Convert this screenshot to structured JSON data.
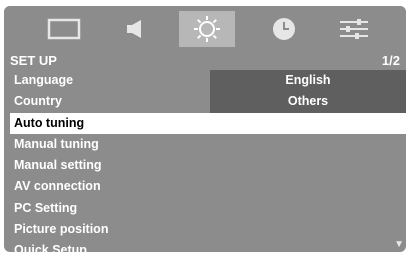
{
  "tabs": [
    {
      "icon": "picture-icon",
      "active": false
    },
    {
      "icon": "speaker-icon",
      "active": false
    },
    {
      "icon": "gear-icon",
      "active": true
    },
    {
      "icon": "clock-icon",
      "active": false
    },
    {
      "icon": "sliders-icon",
      "active": false
    }
  ],
  "header": {
    "title": "SET UP",
    "page": "1/2"
  },
  "menu": [
    {
      "label": "Language",
      "value": "English"
    },
    {
      "label": "Country",
      "value": "Others"
    },
    {
      "label": "Auto tuning"
    },
    {
      "label": "Manual tuning"
    },
    {
      "label": "Manual setting"
    },
    {
      "label": "AV connection"
    },
    {
      "label": "PC Setting"
    },
    {
      "label": "Picture position"
    },
    {
      "label": "Quick Setup"
    }
  ],
  "selected_item": "Auto tuning",
  "colors": {
    "background": "#8c8c8c",
    "active_tab": "#b7b7b7",
    "value_cell": "#5f5f5f",
    "highlight": "#ffffff"
  }
}
